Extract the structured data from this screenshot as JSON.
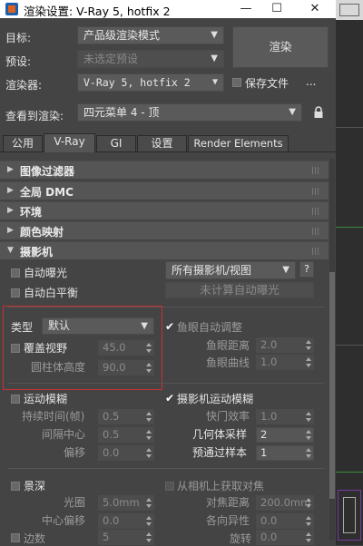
{
  "window": {
    "title": "渲染设置: V-Ray 5, hotfix 2",
    "min": "—",
    "max": "☐",
    "close": "✕"
  },
  "header": {
    "target_label": "目标:",
    "target_value": "产品级渲染模式",
    "preset_label": "预设:",
    "preset_value": "未选定预设",
    "renderer_label": "渲染器:",
    "renderer_value": "V-Ray 5, hotfix 2",
    "save_file_label": "保存文件",
    "more_label": "...",
    "view_label": "查看到渲染:",
    "view_value": "四元菜单 4 - 顶",
    "render_button": "渲染"
  },
  "tabs": [
    "公用",
    "V-Ray",
    "GI",
    "设置",
    "Render Elements"
  ],
  "rollouts": [
    "图像过滤器",
    "全局 DMC",
    "环境",
    "颜色映射",
    "摄影机"
  ],
  "camera": {
    "auto_exposure": "自动曝光",
    "auto_wb": "自动白平衡",
    "all_cameras": "所有摄影机/视图",
    "help": "?",
    "uncalc_btn": "未计算自动曝光",
    "type_label": "类型",
    "type_value": "默认",
    "fisheye_auto": "鱼眼自动调整",
    "override_fov": "覆盖视野",
    "fov_value": "45.0",
    "cyl_height_label": "圆柱体高度",
    "cyl_height_value": "90.0",
    "fisheye_dist_label": "鱼眼距离",
    "fisheye_dist_value": "2.0",
    "fisheye_curve_label": "鱼眼曲线",
    "fisheye_curve_value": "1.0",
    "motion_blur": "运动模糊",
    "duration_label": "持续时间(帧)",
    "duration_value": "0.5",
    "interval_label": "间隔中心",
    "interval_value": "0.5",
    "bias_label": "偏移",
    "bias_value": "0.0",
    "cam_motion_blur": "摄影机运动模糊",
    "shutter_label": "快门效率",
    "shutter_value": "1.0",
    "geo_samples_label": "几何体采样",
    "geo_samples_value": "2",
    "prepass_label": "预通过样本",
    "prepass_value": "1",
    "dof": "景深",
    "from_camera": "从相机上获取对焦",
    "aperture_label": "光圈",
    "aperture_value": "5.0mm",
    "focus_dist_label": "对焦距离",
    "focus_dist_value": "200.0mm",
    "center_bias_label": "中心偏移",
    "center_bias_value": "0.0",
    "anisotropy_label": "各向异性",
    "anisotropy_value": "0.0",
    "sides_label": "边数",
    "sides_value": "5",
    "rotation_label": "旋转",
    "rotation_value": "0.0"
  },
  "colors": {
    "highlight": "#c83030",
    "panel": "#444444"
  }
}
